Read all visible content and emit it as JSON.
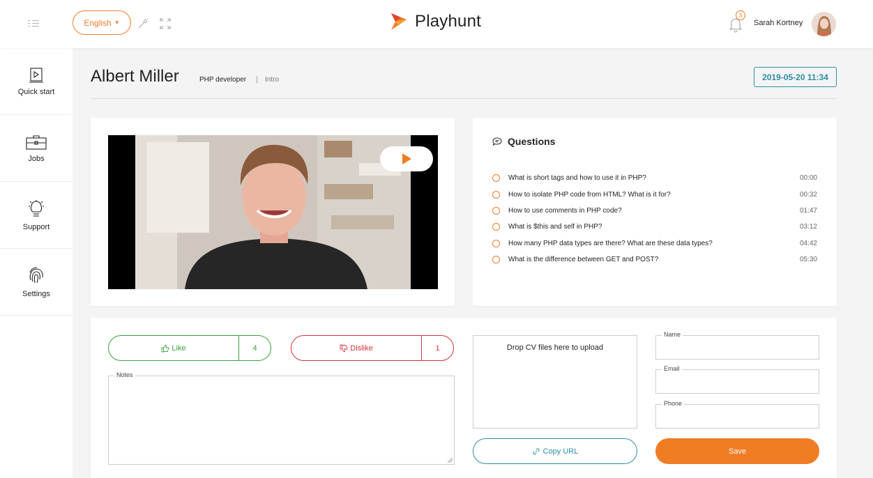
{
  "header": {
    "language": "English",
    "brand": "Playhunt",
    "notification_count": "3",
    "user_name": "Sarah Kortney",
    "icons": [
      "menu-toggle-icon",
      "magic-wand-icon",
      "fullscreen-icon",
      "bell-icon"
    ]
  },
  "sidebar": {
    "items": [
      {
        "label": "Quick start",
        "icon": "play-icon"
      },
      {
        "label": "Jobs",
        "icon": "briefcase-icon"
      },
      {
        "label": "Support",
        "icon": "lightbulb-icon"
      },
      {
        "label": "Settings",
        "icon": "fingerprint-icon"
      }
    ]
  },
  "candidate": {
    "name": "Albert Miller",
    "role": "PHP developer",
    "separator": "|",
    "stage": "Intro",
    "date": "2019-05-20 11:34"
  },
  "questions": {
    "title": "Questions",
    "items": [
      {
        "text": "What is short tags and how to use it in PHP?",
        "time": "00:00"
      },
      {
        "text": "How to isolate PHP code from HTML? What is it for?",
        "time": "00:32"
      },
      {
        "text": "How to use comments in PHP code?",
        "time": "01:47"
      },
      {
        "text": "What is $this and self in PHP?",
        "time": "03:12"
      },
      {
        "text": "How many PHP data types are there? What are these data types?",
        "time": "04:42"
      },
      {
        "text": "What is the difference between GET and POST?",
        "time": "05:30"
      }
    ]
  },
  "feedback": {
    "like_label": "Like",
    "like_count": "4",
    "dislike_label": "Dislike",
    "dislike_count": "1",
    "notes_label": "Notes",
    "notes_value": ""
  },
  "upload": {
    "dropzone_text": "Drop CV files here to upload",
    "copy_url_label": "Copy URL"
  },
  "form": {
    "name_label": "Name",
    "name_value": "",
    "email_label": "Email",
    "email_value": "",
    "phone_label": "Phone",
    "phone_value": "",
    "save_label": "Save"
  },
  "colors": {
    "accent": "#f07d24",
    "teal": "#2f8da0",
    "like": "#3aa13a",
    "dislike": "#d8323c"
  }
}
